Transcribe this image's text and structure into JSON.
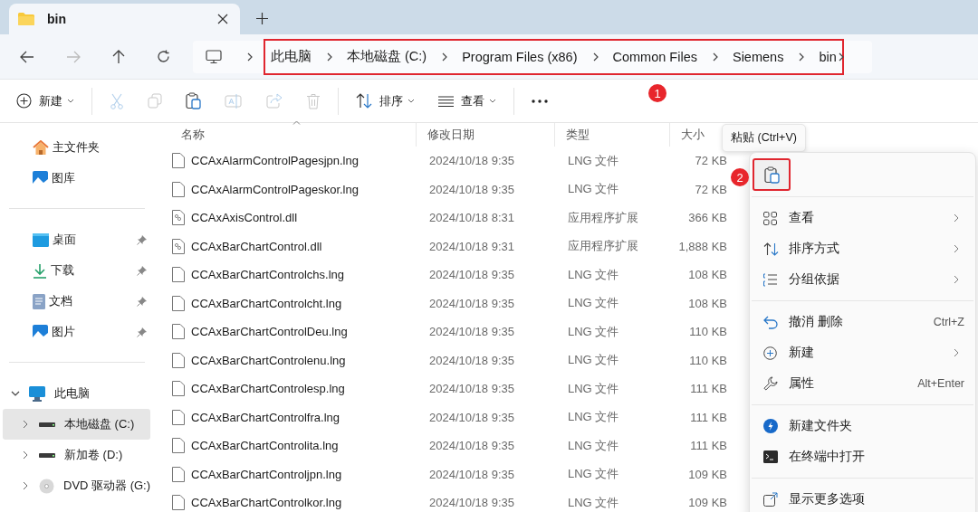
{
  "tab": {
    "title": "bin",
    "selected": true
  },
  "nav": {
    "back_disabled": false,
    "forward_disabled": true
  },
  "breadcrumb": {
    "highlighted": true,
    "items": [
      "此电脑",
      "本地磁盘 (C:)",
      "Program Files (x86)",
      "Common Files",
      "Siemens",
      "bin"
    ]
  },
  "toolbar": [
    {
      "kind": "new",
      "label": "新建",
      "dropdown": true,
      "disabled": false
    },
    {
      "kind": "cut",
      "disabled": true
    },
    {
      "kind": "copy",
      "disabled": true
    },
    {
      "kind": "paste",
      "disabled": false
    },
    {
      "kind": "rename",
      "disabled": true
    },
    {
      "kind": "share",
      "disabled": true
    },
    {
      "kind": "delete",
      "disabled": true
    },
    {
      "kind": "sort",
      "label": "排序",
      "dropdown": true,
      "disabled": false
    },
    {
      "kind": "view",
      "label": "查看",
      "dropdown": true,
      "disabled": false
    },
    {
      "kind": "more"
    }
  ],
  "sidebar": {
    "quick": [
      {
        "kind": "home",
        "label": "主文件夹"
      },
      {
        "kind": "gallery",
        "label": "图库"
      }
    ],
    "pinned": [
      {
        "kind": "desktop",
        "label": "桌面",
        "pinned": true
      },
      {
        "kind": "downloads",
        "label": "下载",
        "pinned": true
      },
      {
        "kind": "documents",
        "label": "文档",
        "pinned": true
      },
      {
        "kind": "pictures",
        "label": "图片",
        "pinned": true
      }
    ],
    "tree": [
      {
        "kind": "pc",
        "label": "此电脑",
        "expanded": true,
        "selected": false,
        "children": [
          {
            "kind": "drive",
            "label": "本地磁盘 (C:)",
            "expanded": false,
            "selected": true
          },
          {
            "kind": "drive",
            "label": "新加卷 (D:)",
            "expanded": false,
            "selected": false
          },
          {
            "kind": "dvd",
            "label": "DVD 驱动器 (G:)",
            "expanded": false,
            "selected": false
          }
        ]
      }
    ]
  },
  "table": {
    "columns": [
      {
        "label": "名称",
        "sorted": true
      },
      {
        "label": "修改日期",
        "sorted": false
      },
      {
        "label": "类型",
        "sorted": false
      },
      {
        "label": "大小",
        "sorted": false
      }
    ],
    "rows": [
      {
        "kind": "file",
        "name": "CCAxAlarmControlPagesjpn.lng",
        "date": "2024/10/18 9:35",
        "type": "LNG 文件",
        "size": "72 KB"
      },
      {
        "kind": "file",
        "name": "CCAxAlarmControlPageskor.lng",
        "date": "2024/10/18 9:35",
        "type": "LNG 文件",
        "size": "72 KB"
      },
      {
        "kind": "dll",
        "name": "CCAxAxisControl.dll",
        "date": "2024/10/18 8:31",
        "type": "应用程序扩展",
        "size": "366 KB"
      },
      {
        "kind": "dll",
        "name": "CCAxBarChartControl.dll",
        "date": "2024/10/18 9:31",
        "type": "应用程序扩展",
        "size": "1,888 KB"
      },
      {
        "kind": "file",
        "name": "CCAxBarChartControlchs.lng",
        "date": "2024/10/18 9:35",
        "type": "LNG 文件",
        "size": "108 KB"
      },
      {
        "kind": "file",
        "name": "CCAxBarChartControlcht.lng",
        "date": "2024/10/18 9:35",
        "type": "LNG 文件",
        "size": "108 KB"
      },
      {
        "kind": "file",
        "name": "CCAxBarChartControlDeu.lng",
        "date": "2024/10/18 9:35",
        "type": "LNG 文件",
        "size": "110 KB"
      },
      {
        "kind": "file",
        "name": "CCAxBarChartControlenu.lng",
        "date": "2024/10/18 9:35",
        "type": "LNG 文件",
        "size": "110 KB"
      },
      {
        "kind": "file",
        "name": "CCAxBarChartControlesp.lng",
        "date": "2024/10/18 9:35",
        "type": "LNG 文件",
        "size": "111 KB"
      },
      {
        "kind": "file",
        "name": "CCAxBarChartControlfra.lng",
        "date": "2024/10/18 9:35",
        "type": "LNG 文件",
        "size": "111 KB"
      },
      {
        "kind": "file",
        "name": "CCAxBarChartControlita.lng",
        "date": "2024/10/18 9:35",
        "type": "LNG 文件",
        "size": "111 KB"
      },
      {
        "kind": "file",
        "name": "CCAxBarChartControljpn.lng",
        "date": "2024/10/18 9:35",
        "type": "LNG 文件",
        "size": "109 KB"
      },
      {
        "kind": "file",
        "name": "CCAxBarChartControlkor.lng",
        "date": "2024/10/18 9:35",
        "type": "LNG 文件",
        "size": "109 KB"
      }
    ]
  },
  "tooltip": "粘贴 (Ctrl+V)",
  "context_menu": {
    "paste_button": {
      "highlighted": true
    },
    "groups": [
      [
        {
          "kind": "view",
          "label": "查看",
          "submenu": true
        },
        {
          "kind": "sort",
          "label": "排序方式",
          "submenu": true
        },
        {
          "kind": "group",
          "label": "分组依据",
          "submenu": true
        }
      ],
      [
        {
          "kind": "undo",
          "label": "撤消 删除",
          "shortcut": "Ctrl+Z",
          "submenu": false
        },
        {
          "kind": "new",
          "label": "新建",
          "submenu": true
        },
        {
          "kind": "properties",
          "label": "属性",
          "shortcut": "Alt+Enter",
          "submenu": false
        }
      ],
      [
        {
          "kind": "newfolder",
          "label": "新建文件夹",
          "submenu": false
        },
        {
          "kind": "terminal",
          "label": "在终端中打开",
          "submenu": false
        }
      ],
      [
        {
          "kind": "more",
          "label": "显示更多选项",
          "submenu": false
        }
      ]
    ]
  },
  "annotations": [
    {
      "label": "1"
    },
    {
      "label": "2"
    }
  ]
}
